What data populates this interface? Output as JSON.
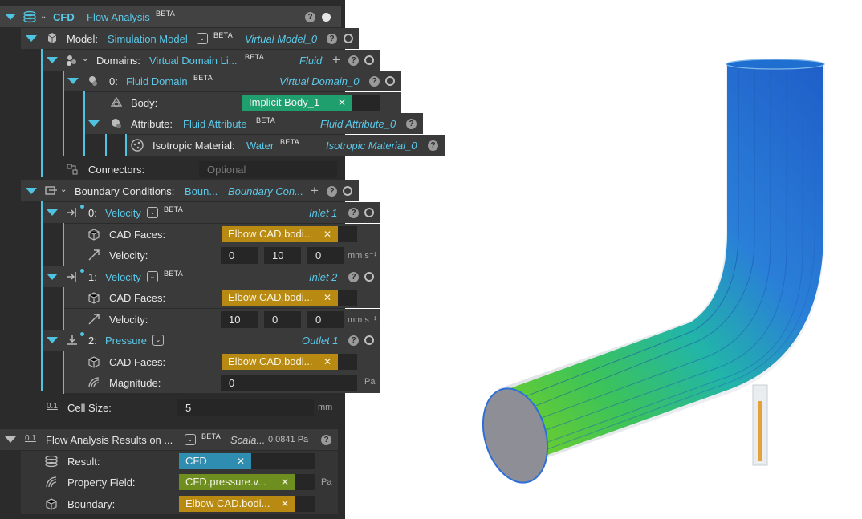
{
  "root": {
    "type_label": "CFD",
    "name": "Flow Analysis",
    "beta": "BETA"
  },
  "model": {
    "label": "Model:",
    "name": "Simulation Model",
    "beta": "BETA",
    "instance": "Virtual Model_0"
  },
  "domains": {
    "label": "Domains:",
    "name": "Virtual Domain Li...",
    "beta": "BETA",
    "instance": "Fluid"
  },
  "fluid_domain": {
    "index": "0:",
    "name": "Fluid Domain",
    "beta": "BETA",
    "instance": "Virtual Domain_0"
  },
  "body": {
    "label": "Body:",
    "chip": "Implicit Body_1"
  },
  "attribute": {
    "label": "Attribute:",
    "name": "Fluid Attribute",
    "beta": "BETA",
    "instance": "Fluid Attribute_0"
  },
  "material": {
    "label": "Isotropic Material:",
    "name": "Water",
    "beta": "BETA",
    "instance": "Isotropic Material_0"
  },
  "connectors": {
    "label": "Connectors:",
    "placeholder": "Optional"
  },
  "boundary_conditions": {
    "label": "Boundary Conditions:",
    "name": "Boun...",
    "instance": "Boundary Con..."
  },
  "velocity0": {
    "index": "0:",
    "name": "Velocity",
    "beta": "BETA",
    "instance": "Inlet 1",
    "faces_label": "CAD Faces:",
    "faces_chip": "Elbow CAD.bodi...",
    "vel_label": "Velocity:",
    "vx": "0",
    "vy": "10",
    "vz": "0",
    "unit": "mm s⁻¹"
  },
  "velocity1": {
    "index": "1:",
    "name": "Velocity",
    "beta": "BETA",
    "instance": "Inlet 2",
    "faces_label": "CAD Faces:",
    "faces_chip": "Elbow CAD.bodi...",
    "vel_label": "Velocity:",
    "vx": "10",
    "vy": "0",
    "vz": "0",
    "unit": "mm s⁻¹"
  },
  "pressure": {
    "index": "2:",
    "name": "Pressure",
    "instance": "Outlet 1",
    "faces_label": "CAD Faces:",
    "faces_chip": "Elbow CAD.bodi...",
    "mag_label": "Magnitude:",
    "mag": "0",
    "unit": "Pa"
  },
  "cell_size": {
    "label": "Cell Size:",
    "value": "5",
    "unit": "mm"
  },
  "results": {
    "label": "Flow Analysis Results on ...",
    "beta": "BETA",
    "instance": "Scala...",
    "value": "0.0841 Pa",
    "result_label": "Result:",
    "result_chip": "CFD",
    "property_label": "Property Field:",
    "property_chip": "CFD.pressure.v...",
    "property_unit": "Pa",
    "boundary_label": "Boundary:",
    "boundary_chip": "Elbow CAD.bodi..."
  },
  "colors": {
    "accent": "#4fc3e0",
    "panel": "#2b2b2b",
    "gold_chip": "#b88a11",
    "green_chip": "#1f9e6e"
  }
}
